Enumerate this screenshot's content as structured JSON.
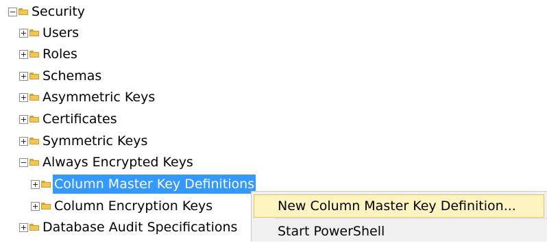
{
  "tree": {
    "root": {
      "label": "Security",
      "expanded": true
    },
    "children": [
      {
        "label": "Users",
        "expanded": false
      },
      {
        "label": "Roles",
        "expanded": false
      },
      {
        "label": "Schemas",
        "expanded": false
      },
      {
        "label": "Asymmetric Keys",
        "expanded": false
      },
      {
        "label": "Certificates",
        "expanded": false
      },
      {
        "label": "Symmetric Keys",
        "expanded": false
      },
      {
        "label": "Always Encrypted Keys",
        "expanded": true
      },
      {
        "label": "Column Master Key Definitions",
        "expanded": false,
        "selected": true
      },
      {
        "label": "Column Encryption Keys",
        "expanded": false
      },
      {
        "label": "Database Audit Specifications",
        "expanded": false
      }
    ]
  },
  "context_menu": {
    "items": [
      {
        "label": "New Column Master Key Definition...",
        "highlighted": true
      },
      {
        "label": "Start PowerShell",
        "highlighted": false
      }
    ]
  },
  "colors": {
    "selection": "#3399ff",
    "menu_highlight": "#fdf4bf",
    "folder": "#f2c55c"
  }
}
